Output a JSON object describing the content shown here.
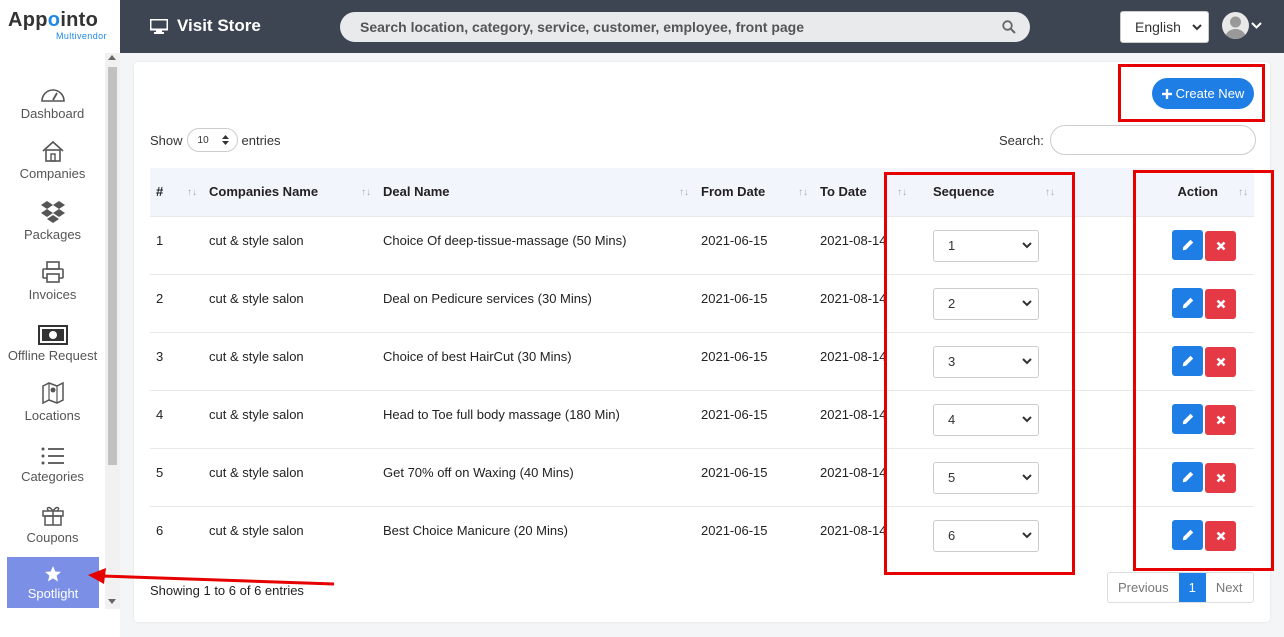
{
  "logo": {
    "name_pre": "App",
    "name_o": "o",
    "name_post": "into",
    "sub": "Multivendor"
  },
  "header": {
    "visit_store": "Visit Store",
    "search_placeholder": "Search location, category, service, customer, employee, front page",
    "language": "English"
  },
  "sidebar": {
    "items": [
      {
        "label": "Dashboard",
        "icon": "dashboard-icon"
      },
      {
        "label": "Companies",
        "icon": "home-icon"
      },
      {
        "label": "Packages",
        "icon": "dropbox-icon"
      },
      {
        "label": "Invoices",
        "icon": "printer-icon"
      },
      {
        "label": "Offline Request",
        "icon": "money-icon"
      },
      {
        "label": "Locations",
        "icon": "map-icon"
      },
      {
        "label": "Categories",
        "icon": "list-icon"
      },
      {
        "label": "Coupons",
        "icon": "gift-icon"
      },
      {
        "label": "Spotlight",
        "icon": "star-icon"
      }
    ]
  },
  "toolbar": {
    "create_label": "Create New"
  },
  "table_controls": {
    "show_label": "Show",
    "entries_label": "entries",
    "page_size": "10",
    "search_label": "Search:"
  },
  "table": {
    "columns": [
      "#",
      "Companies Name",
      "Deal Name",
      "From Date",
      "To Date",
      "Sequence",
      "Action"
    ],
    "rows": [
      {
        "num": "1",
        "company": "cut & style salon",
        "deal": "Choice Of deep-tissue-massage (50 Mins)",
        "from": "2021-06-15",
        "to": "2021-08-14",
        "seq": "1"
      },
      {
        "num": "2",
        "company": "cut & style salon",
        "deal": "Deal on Pedicure services (30 Mins)",
        "from": "2021-06-15",
        "to": "2021-08-14",
        "seq": "2"
      },
      {
        "num": "3",
        "company": "cut & style salon",
        "deal": "Choice of best HairCut (30 Mins)",
        "from": "2021-06-15",
        "to": "2021-08-14",
        "seq": "3"
      },
      {
        "num": "4",
        "company": "cut & style salon",
        "deal": "Head to Toe full body massage (180 Min)",
        "from": "2021-06-15",
        "to": "2021-08-14",
        "seq": "4"
      },
      {
        "num": "5",
        "company": "cut & style salon",
        "deal": "Get 70% off on Waxing (40 Mins)",
        "from": "2021-06-15",
        "to": "2021-08-14",
        "seq": "5"
      },
      {
        "num": "6",
        "company": "cut & style salon",
        "deal": "Best Choice Manicure (20 Mins)",
        "from": "2021-06-15",
        "to": "2021-08-14",
        "seq": "6"
      }
    ]
  },
  "footer": {
    "showing": "Showing 1 to 6 of 6 entries",
    "previous": "Previous",
    "page": "1",
    "next": "Next"
  },
  "colors": {
    "primary": "#1e7ee6",
    "danger": "#e63946",
    "topbar": "#3d4552",
    "spotlight": "#7b8fe6",
    "annotation": "#e60000"
  }
}
